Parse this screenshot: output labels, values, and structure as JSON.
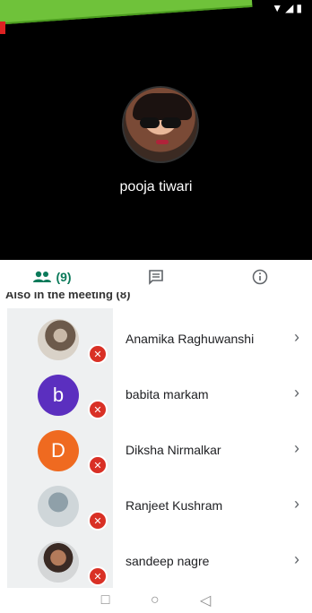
{
  "video": {
    "participant_name": "pooja tiwari"
  },
  "tabs": [
    {
      "label": "(9)",
      "icon": "people-icon",
      "active": true
    },
    {
      "label": "",
      "icon": "chat-icon",
      "active": false
    },
    {
      "label": "",
      "icon": "info-icon",
      "active": false
    }
  ],
  "list": {
    "header": "Also in the meeting (8)",
    "participants": [
      {
        "name": "Anamika Raghuwanshi",
        "avatar": "photo",
        "initial": "",
        "muted": true
      },
      {
        "name": "babita markam",
        "avatar": "letter",
        "initial": "b",
        "color": "#5b2fbf",
        "muted": true
      },
      {
        "name": "Diksha Nirmalkar",
        "avatar": "letter",
        "initial": "D",
        "color": "#ef6a20",
        "muted": true
      },
      {
        "name": "Ranjeet Kushram",
        "avatar": "photo",
        "initial": "",
        "muted": true
      },
      {
        "name": "sandeep nagre",
        "avatar": "photo",
        "initial": "",
        "muted": true
      }
    ]
  },
  "navbar": {
    "recents": "□",
    "home": "○",
    "back": "◁"
  },
  "colors": {
    "accent": "#0b7a5a",
    "mute": "#d93025"
  }
}
